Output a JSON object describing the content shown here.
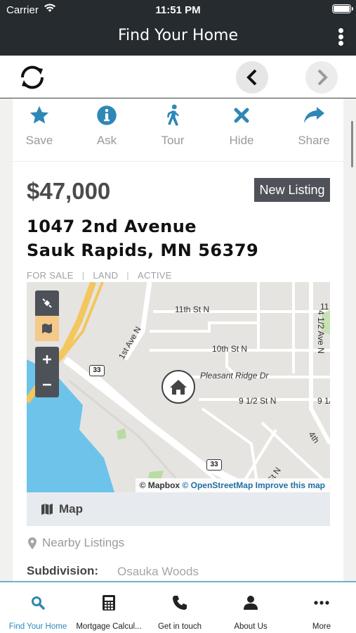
{
  "status": {
    "carrier": "Carrier",
    "time": "11:51 PM"
  },
  "nav": {
    "title": "Find Your Home"
  },
  "actions": [
    {
      "label": "Save",
      "icon": "star-icon"
    },
    {
      "label": "Ask",
      "icon": "info-icon"
    },
    {
      "label": "Tour",
      "icon": "walking-icon"
    },
    {
      "label": "Hide",
      "icon": "close-icon"
    },
    {
      "label": "Share",
      "icon": "share-icon"
    }
  ],
  "listing": {
    "price": "$47,000",
    "badge": "New Listing",
    "address_line1": "1047 2nd Avenue",
    "address_line2": "Sauk Rapids, MN 56379",
    "meta": [
      "FOR SALE",
      "LAND",
      "ACTIVE"
    ]
  },
  "map": {
    "streets": [
      "11th St N",
      "10th St N",
      "Pleasant Ridge Dr",
      "9 1/2 St N",
      "1st Ave N",
      "4 1/2 Ave N",
      "4th",
      "St N",
      "11",
      "9 1/"
    ],
    "highway_shields": [
      "33",
      "33"
    ],
    "attribution": {
      "mapbox": "© Mapbox",
      "osm": "© OpenStreetMap",
      "improve": "Improve this map"
    },
    "footer_label": "Map"
  },
  "nearby_label": "Nearby Listings",
  "subdivision": {
    "key": "Subdivision:",
    "value": "Osauka Woods"
  },
  "tabs": [
    {
      "label": "Find Your Home",
      "icon": "search-icon",
      "active": true
    },
    {
      "label": "Mortgage Calcul...",
      "icon": "calculator-icon",
      "active": false
    },
    {
      "label": "Get in touch",
      "icon": "phone-icon",
      "active": false
    },
    {
      "label": "About Us",
      "icon": "user-icon",
      "active": false
    },
    {
      "label": "More",
      "icon": "more-icon",
      "active": false
    }
  ],
  "colors": {
    "accent": "#2f87b6",
    "header": "#252b2f",
    "badge": "#4f5258"
  }
}
